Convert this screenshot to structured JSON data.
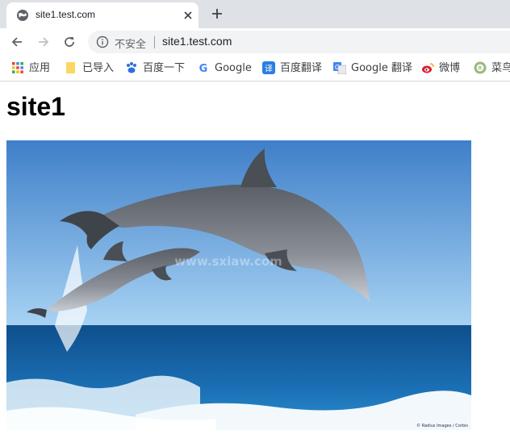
{
  "tab": {
    "title": "site1.test.com",
    "favicon": "globe-icon",
    "close_icon": "close-icon"
  },
  "new_tab_icon": "plus-icon",
  "toolbar": {
    "back_icon": "back-arrow-icon",
    "forward_icon": "forward-arrow-icon",
    "reload_icon": "reload-icon"
  },
  "omnibox": {
    "security_icon": "info-icon",
    "security_label": "不安全",
    "url": "site1.test.com"
  },
  "bookmarks": [
    {
      "label": "应用",
      "icon": "apps-grid-icon"
    },
    {
      "label": "已导入",
      "icon": "folder-icon"
    },
    {
      "label": "百度一下",
      "icon": "baidu-paw-icon"
    },
    {
      "label": "Google",
      "icon": "google-icon"
    },
    {
      "label": "百度翻译",
      "icon": "baidu-translate-icon"
    },
    {
      "label": "Google 翻译",
      "icon": "google-translate-icon"
    },
    {
      "label": "微博",
      "icon": "weibo-icon"
    },
    {
      "label": "菜鸟",
      "icon": "runoob-icon"
    }
  ],
  "page": {
    "heading": "site1",
    "image_alt": "dolphins-jumping-photo",
    "watermark_text": "www.sxiaw.com",
    "photo_credit": "© Radius Images / Corbis"
  },
  "colors": {
    "tabstrip": "#dee1e6",
    "omnibox": "#f1f3f4",
    "sky_top": "#3f7fc9",
    "sky_horizon": "#a8d3f3",
    "sea_dark": "#0f4f8c",
    "sea_light": "#2b8fd0"
  }
}
